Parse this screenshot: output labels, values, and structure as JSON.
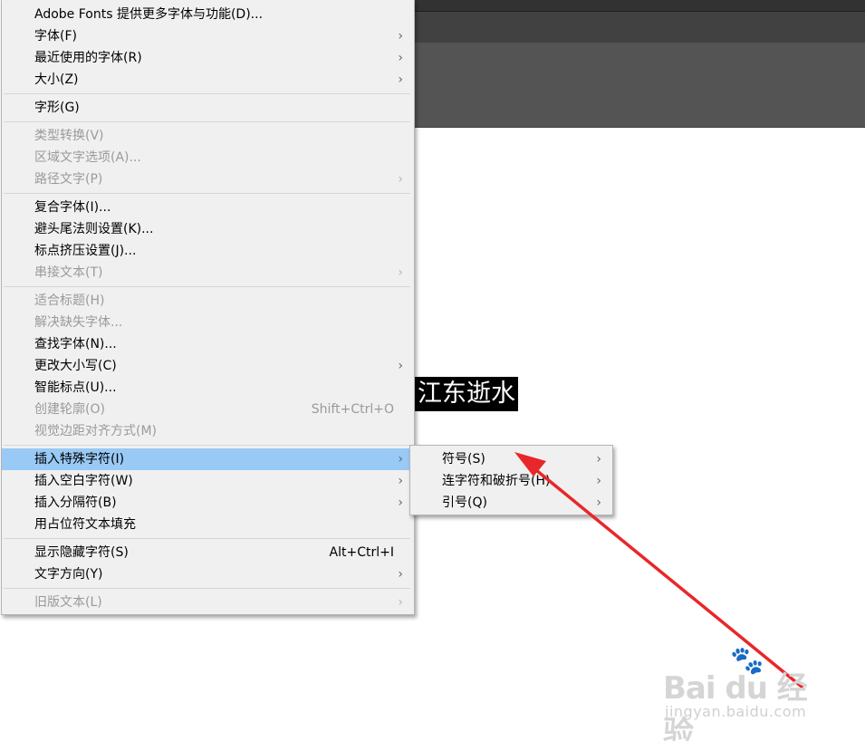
{
  "canvas": {
    "selected_text": "江东逝水"
  },
  "main_menu": {
    "groups": [
      [
        {
          "label": "Adobe Fonts 提供更多字体与功能(D)...",
          "enabled": true,
          "submenu": false
        },
        {
          "label": "字体(F)",
          "enabled": true,
          "submenu": true
        },
        {
          "label": "最近使用的字体(R)",
          "enabled": true,
          "submenu": true
        },
        {
          "label": "大小(Z)",
          "enabled": true,
          "submenu": true
        }
      ],
      [
        {
          "label": "字形(G)",
          "enabled": true,
          "submenu": false
        }
      ],
      [
        {
          "label": "类型转换(V)",
          "enabled": false,
          "submenu": false
        },
        {
          "label": "区域文字选项(A)...",
          "enabled": false,
          "submenu": false
        },
        {
          "label": "路径文字(P)",
          "enabled": false,
          "submenu": true
        }
      ],
      [
        {
          "label": "复合字体(I)...",
          "enabled": true,
          "submenu": false
        },
        {
          "label": "避头尾法则设置(K)...",
          "enabled": true,
          "submenu": false
        },
        {
          "label": "标点挤压设置(J)...",
          "enabled": true,
          "submenu": false
        },
        {
          "label": "串接文本(T)",
          "enabled": false,
          "submenu": true
        }
      ],
      [
        {
          "label": "适合标题(H)",
          "enabled": false,
          "submenu": false
        },
        {
          "label": "解决缺失字体...",
          "enabled": false,
          "submenu": false
        },
        {
          "label": "查找字体(N)...",
          "enabled": true,
          "submenu": false
        },
        {
          "label": "更改大小写(C)",
          "enabled": true,
          "submenu": true
        },
        {
          "label": "智能标点(U)...",
          "enabled": true,
          "submenu": false
        },
        {
          "label": "创建轮廓(O)",
          "enabled": false,
          "submenu": false,
          "shortcut": "Shift+Ctrl+O"
        },
        {
          "label": "视觉边距对齐方式(M)",
          "enabled": false,
          "submenu": false
        }
      ],
      [
        {
          "label": "插入特殊字符(I)",
          "enabled": true,
          "submenu": true,
          "highlighted": true
        },
        {
          "label": "插入空白字符(W)",
          "enabled": true,
          "submenu": true
        },
        {
          "label": "插入分隔符(B)",
          "enabled": true,
          "submenu": true
        },
        {
          "label": "用占位符文本填充",
          "enabled": true,
          "submenu": false
        }
      ],
      [
        {
          "label": "显示隐藏字符(S)",
          "enabled": true,
          "submenu": false,
          "shortcut": "Alt+Ctrl+I"
        },
        {
          "label": "文字方向(Y)",
          "enabled": true,
          "submenu": true
        }
      ],
      [
        {
          "label": "旧版文本(L)",
          "enabled": false,
          "submenu": true
        }
      ]
    ]
  },
  "sub_menu": {
    "items": [
      {
        "label": "符号(S)",
        "submenu": true
      },
      {
        "label": "连字符和破折号(H)",
        "submenu": true
      },
      {
        "label": "引号(Q)",
        "submenu": true
      }
    ]
  },
  "icons": {
    "submenu_arrow": "chevron-right-icon",
    "submenu_arrow_glyph": "›"
  },
  "watermark": {
    "logo": "Bai du 经验",
    "url": "jingyan.baidu.com"
  },
  "colors": {
    "highlight": "#99c9f5",
    "menu_bg": "#f0f0f0",
    "annotation": "#e8272b"
  }
}
